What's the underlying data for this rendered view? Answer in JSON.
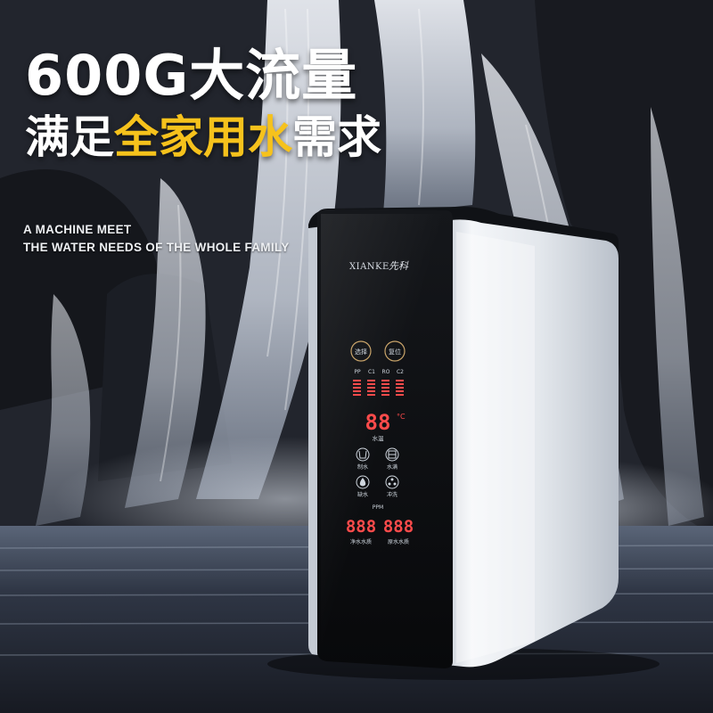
{
  "headline": "600G大流量",
  "subheadline": {
    "part1": "满足",
    "part2": "全家用水",
    "part3": "需求"
  },
  "tagline": {
    "line1": "A MACHINE MEET",
    "line2": "THE WATER NEEDS OF THE WHOLE FAMILY"
  },
  "device": {
    "brand_latin": "XIANKE",
    "brand_cn": "先科",
    "buttons": [
      "选择",
      "复位"
    ],
    "filters": [
      "PP",
      "C1",
      "RO",
      "C2"
    ],
    "temperature": {
      "value": "88",
      "unit": "°C",
      "label": "水温"
    },
    "functions": [
      {
        "label": "制水",
        "icon": "cup-icon"
      },
      {
        "label": "水满",
        "icon": "tank-icon"
      },
      {
        "label": "缺水",
        "icon": "water-drop-icon"
      },
      {
        "label": "冲洗",
        "icon": "flush-icon"
      }
    ],
    "ppm_label": "PPM",
    "tds": [
      {
        "value": "888",
        "label": "净水水质"
      },
      {
        "value": "888",
        "label": "原水水质"
      }
    ]
  },
  "colors": {
    "accent_yellow": "#f6c21c",
    "panel_black": "#0c0d10",
    "led_red": "#ff4b4b",
    "casing_silver": "#dfe4ea"
  }
}
